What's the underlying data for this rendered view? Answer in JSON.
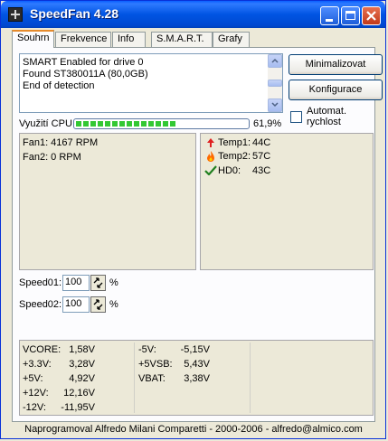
{
  "window": {
    "title": "SpeedFan 4.28"
  },
  "tabs": [
    {
      "label": "Souhrn"
    },
    {
      "label": "Frekvence"
    },
    {
      "label": "Info"
    },
    {
      "label": "S.M.A.R.T."
    },
    {
      "label": "Grafy"
    }
  ],
  "log": {
    "lines": [
      "SMART Enabled for drive 0",
      "Found ST380011A (80,0GB)",
      "End of detection"
    ]
  },
  "buttons": {
    "minimize": "Minimalizovat",
    "configure": "Konfigurace"
  },
  "auto_speed": {
    "label_line1": "Automat.",
    "label_line2": "rychlost",
    "checked": false
  },
  "cpu": {
    "label": "Využití CPU",
    "value": "61,9%",
    "fraction": 0.619
  },
  "fans": [
    {
      "text": "Fan1: 4167 RPM"
    },
    {
      "text": "Fan2: 0 RPM"
    }
  ],
  "temps": [
    {
      "label": "Temp1:",
      "value": "44C",
      "icon": "arrow-up-icon",
      "color": "#e02020"
    },
    {
      "label": "Temp2:",
      "value": "57C",
      "icon": "flame-icon",
      "color": "#ff6a00"
    },
    {
      "label": "HD0:",
      "value": "43C",
      "icon": "check-icon",
      "color": "#208020"
    }
  ],
  "speeds": [
    {
      "label": "Speed01:",
      "value": "100",
      "unit": "%"
    },
    {
      "label": "Speed02:",
      "value": "100",
      "unit": "%"
    }
  ],
  "voltages_left": [
    {
      "label": "VCORE:",
      "value": "1,58V"
    },
    {
      "label": "+3.3V:",
      "value": "3,28V"
    },
    {
      "label": "+5V:",
      "value": "4,92V"
    },
    {
      "label": "+12V:",
      "value": "12,16V"
    },
    {
      "label": "-12V:",
      "value": "-11,95V"
    }
  ],
  "voltages_right": [
    {
      "label": "-5V:",
      "value": "-5,15V"
    },
    {
      "label": "+5VSB:",
      "value": "5,43V"
    },
    {
      "label": "VBAT:",
      "value": "3,38V"
    }
  ],
  "footer": "Naprogramoval Alfredo Milani Comparetti - 2000-2006 - alfredo@almico.com"
}
